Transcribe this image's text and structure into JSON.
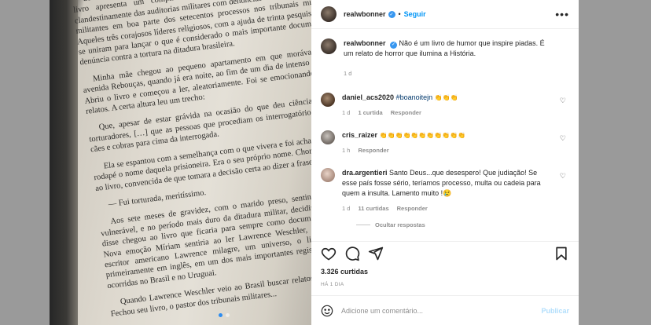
{
  "photo": {
    "page_paragraphs": [
      "dom Paulo Evaristo Arns, o pastor Jaime Wright e o rabino Henry Sobel, o livro apresenta um compilado de trechos de documentos desviados clandestinamente das auditorias militares com denúncias de torturas feitas por militantes em boa parte dos setecentos processos nos tribunais militares. Aqueles três corajosos líderes religiosos, com a ajuda de trinta pesquisadores, se uniram para lançar o que é considerado o mais importante documento de denúncia contra a tortura na ditadura brasileira.",
      "Minha mãe chegou ao pequeno apartamento em que morávamos, na avenida Rebouças, quando já era noite, ao fim de um dia de intenso trabalho. Abriu o livro e começou a ler, aleatoriamente. Foi se emocionando com os relatos. A certa altura leu um trecho:",
      "Que, apesar de estar grávida na ocasião do que deu ciência aos seus torturadores, […] que as pessoas que procediam os interrogatórios soltavam cães e cobras para cima da interrogada.",
      "Ela se espantou com a semelhança com o que vivera e foi achar na nota de rodapé o nome daquela prisioneira. Era o seu próprio nome. Chorou abraçada ao livro, convencida de que tomara a decisão certa ao dizer a frase:",
      "— Fui torturada, meritíssimo.",
      "Aos sete meses de gravidez, com o marido preso, sentindo-se fraca e vulnerável, e no período mais duro da ditadura militar, decidiu falar. O que disse chegou ao livro que ficaria para sempre como documento histórico. Nova emoção Míriam sentiria ao ler Lawrence Weschler, do prestigiado escritor americano Lawrence milagre, um universo, o livro, publicado primeiramente em inglês, em um dos mais importantes registros de torturas ocorridas no Brasil e no Uruguai.",
      "Quando Lawrence Weschler veio ao Brasil buscar relatos, ligou para ela. Fechou seu livro, o pastor dos tribunais militares..."
    ]
  },
  "header": {
    "username": "realwbonner",
    "separator": "•",
    "follow_label": "Seguir",
    "more_label": "•••"
  },
  "caption": {
    "username": "realwbonner",
    "text": "Não é um livro de humor que inspire piadas. É um relato de horror que ilumina a História.",
    "time": "1 d"
  },
  "comments": [
    {
      "username": "daniel_acs2020",
      "hashtag": "#boanoitejn",
      "emojis": "👏👏👏",
      "time": "1 d",
      "likes": "1 curtida",
      "reply_label": "Responder"
    },
    {
      "username": "cris_raizer",
      "emojis": "👏👏👏👏👏👏👏👏👏👏👏",
      "time": "1 h",
      "reply_label": "Responder"
    },
    {
      "username": "dra.argentieri",
      "text": "Santo Deus...que desespero! Que judiação! Se esse país fosse sério, teríamos processo, multa ou cadeia para quem a insulta. Lamento muito !😢",
      "time": "1 d",
      "likes": "11 curtidas",
      "reply_label": "Responder",
      "hidden_replies": "Ocultar respostas"
    }
  ],
  "actions": {
    "likes_count": "3.326 curtidas",
    "time_ago": "HÁ 1 DIA"
  },
  "add_comment": {
    "placeholder": "Adicione um comentário...",
    "post_label": "Publicar"
  },
  "carousel": {
    "count": 2,
    "active": 1
  },
  "colors": {
    "accent": "#0095f6",
    "verified": "#3897f0",
    "muted": "#8e8e8e",
    "hashtag": "#00376b",
    "post_disabled": "#b2dffc"
  },
  "icons": [
    "verified-icon",
    "more-icon",
    "heart-icon",
    "comment-icon",
    "share-icon",
    "bookmark-icon",
    "emoji-icon"
  ]
}
